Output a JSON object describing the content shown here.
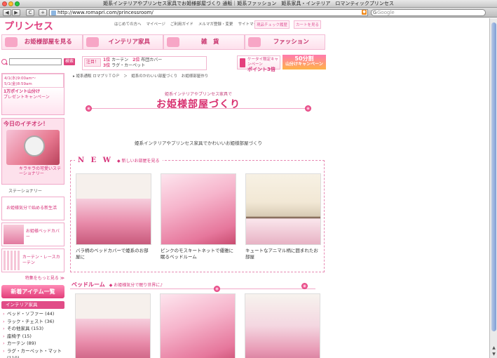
{
  "window": {
    "title": "姫系インテリアやプリンセス家具でお姫様部屋づくり 通販｜姫系ファッション　姫系家具・インテリア　ロマンティックプリンセス"
  },
  "toolbar": {
    "back": "◀",
    "forward": "▶",
    "reload": "C",
    "add": "+",
    "url": "http://www.romapri.com/princessroom/",
    "rss": "RSS",
    "search_placeholder": "Google",
    "search_glyph": "G"
  },
  "header": {
    "logo": "プリンセス",
    "nav": [
      "はじめての方へ",
      "マイページ",
      "ご利用ガイド",
      "メルマガ登録・変更",
      "サイトマップ"
    ],
    "right_links": [
      "現品チェック履歴",
      "カートを見る"
    ]
  },
  "category_banners": [
    "お姫様部屋を見る",
    "インテリア家具",
    "雑　貨",
    "ファッション"
  ],
  "search": {
    "button": "検索"
  },
  "notice": {
    "tag": "注目！",
    "line1_rank1": "1位",
    "line1_item1": "カーテン",
    "line1_rank2": "2位",
    "line1_item2": "布団カバー",
    "line2_rank": "3位",
    "line2_item": "ラグ・カーペット"
  },
  "promos": {
    "mobile_line1": "ケータイ限定キャンペーン",
    "mobile_line2": "ポイント3倍",
    "installment_line1": "50分割",
    "installment_line2": "山分けキャンペーン"
  },
  "sidebar": {
    "date_range": "4/1(水)9:00am〜5/1(金)8:59am",
    "campaign_text": "1万ポイント山分け",
    "present_text": "プレゼントキャンペーン",
    "ichioshi_title": "今日のイチオシ！",
    "ichioshi_caption": "キラキラの可愛いステーショナリー",
    "ichioshi_category": "ステーショナリー",
    "mini_banners": [
      {
        "text": "お姫様気分で始める新生活"
      },
      {
        "text": "お姫様ベッドカバー"
      },
      {
        "text": "カーテン・レースカーテン"
      }
    ],
    "more_features": "特集をもっと見る ≫",
    "new_items": "新着アイテム一覧",
    "interior_header": "インテリア家具",
    "categories": [
      "ベッド・ソファー (44)",
      "ラック・チェスト (36)",
      "その他家具 (153)",
      "座椅子 (15)",
      "カーテン (89)",
      "ラグ・カーペット・マット (110)"
    ]
  },
  "main": {
    "breadcrumb": "▸ 姫系通販 ロマプリＴＯＰ　＞　姫系のかわいい部屋づくり　お姫様部屋作り",
    "title_sub": "姫系インテリアやプリンセス家具で",
    "title": "お姫様部屋づくり",
    "description": "姫系インテリアやプリンセス家具でかわいいお姫様部屋づくり",
    "new_section": {
      "heading": "N E W",
      "subheading": "◆ 新しいお部屋を見る",
      "cards": [
        {
          "caption": "バラ柄のベッドカバーで姫系のお部屋に"
        },
        {
          "caption": "ピンクのモスキートネットで優雅に眠るベッドルーム"
        },
        {
          "caption": "キュートなアニマル柄に囲まれたお部屋"
        }
      ]
    },
    "bed_section": {
      "heading": "ベッドルーム",
      "subheading": "◆ お姫様気分で眠り世界に♪"
    }
  }
}
